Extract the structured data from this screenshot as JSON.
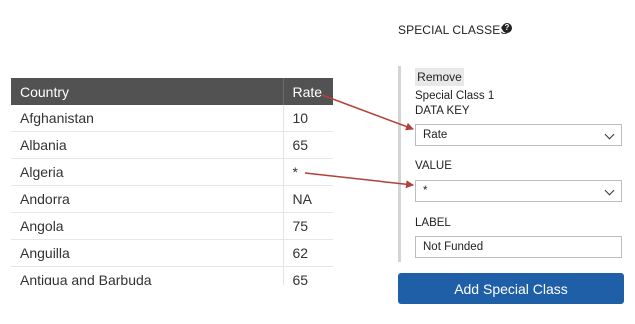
{
  "table": {
    "headers": [
      "Country",
      "Rate"
    ],
    "rows": [
      {
        "country": "Afghanistan",
        "rate": "10"
      },
      {
        "country": "Albania",
        "rate": "65"
      },
      {
        "country": "Algeria",
        "rate": "*"
      },
      {
        "country": "Andorra",
        "rate": "NA"
      },
      {
        "country": "Angola",
        "rate": "75"
      },
      {
        "country": "Anguilla",
        "rate": "62"
      },
      {
        "country": "Antigua and Barbuda",
        "rate": "65"
      }
    ]
  },
  "special_classes": {
    "title": "SPECIAL CLASSES",
    "help_icon": "question-circle-icon",
    "remove_label": "Remove",
    "class_name": "Special Class 1",
    "data_key_label": "DATA KEY",
    "data_key_value": "Rate",
    "value_label": "VALUE",
    "value_value": "*",
    "label_label": "LABEL",
    "label_value": "Not Funded",
    "add_button": "Add Special Class"
  },
  "colors": {
    "header_bg": "#525252",
    "arrow": "#b5403a",
    "primary_button": "#1e5fa8"
  }
}
